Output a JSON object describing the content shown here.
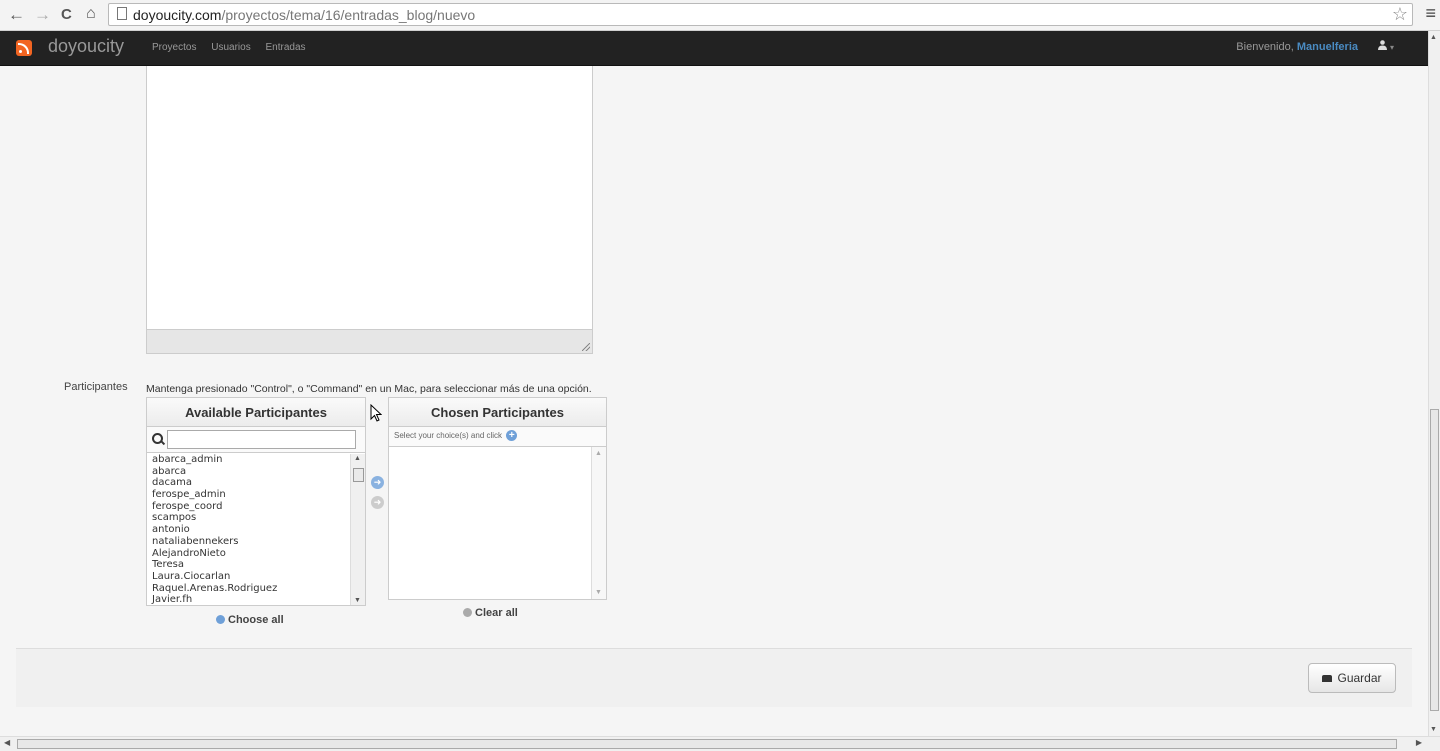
{
  "browser": {
    "url_host": "doyoucity.com",
    "url_path": "/proyectos/tema/16/entradas_blog/nuevo",
    "back": "←",
    "forward": "→",
    "reload": "C",
    "home": "⌂",
    "star": "☆",
    "menu": "≡"
  },
  "navbar": {
    "brand": "doyoucity",
    "links": [
      "Proyectos",
      "Usuarios",
      "Entradas"
    ],
    "welcome": "Bienvenido,",
    "username": "Manuelferia"
  },
  "form": {
    "participantes_label": "Participantes",
    "help_text": "Mantenga presionado \"Control\", o \"Command\" en un Mac, para seleccionar más de una opción.",
    "available_title": "Available Participantes",
    "filter_value": "",
    "available_items": [
      "abarca_admin",
      "abarca",
      "dacama",
      "ferospe_admin",
      "ferospe_coord",
      "scampos",
      "antonio",
      "nataliabennekers",
      "AlejandroNieto",
      "Teresa",
      "Laura.Ciocarlan",
      "Raquel.Arenas.Rodriguez",
      "Javier.fh"
    ],
    "chosen_title": "Chosen Participantes",
    "chosen_hint": "Select your choice(s) and click",
    "choose_all": "Choose all",
    "clear_all": "Clear all",
    "save_label": "Guardar"
  }
}
